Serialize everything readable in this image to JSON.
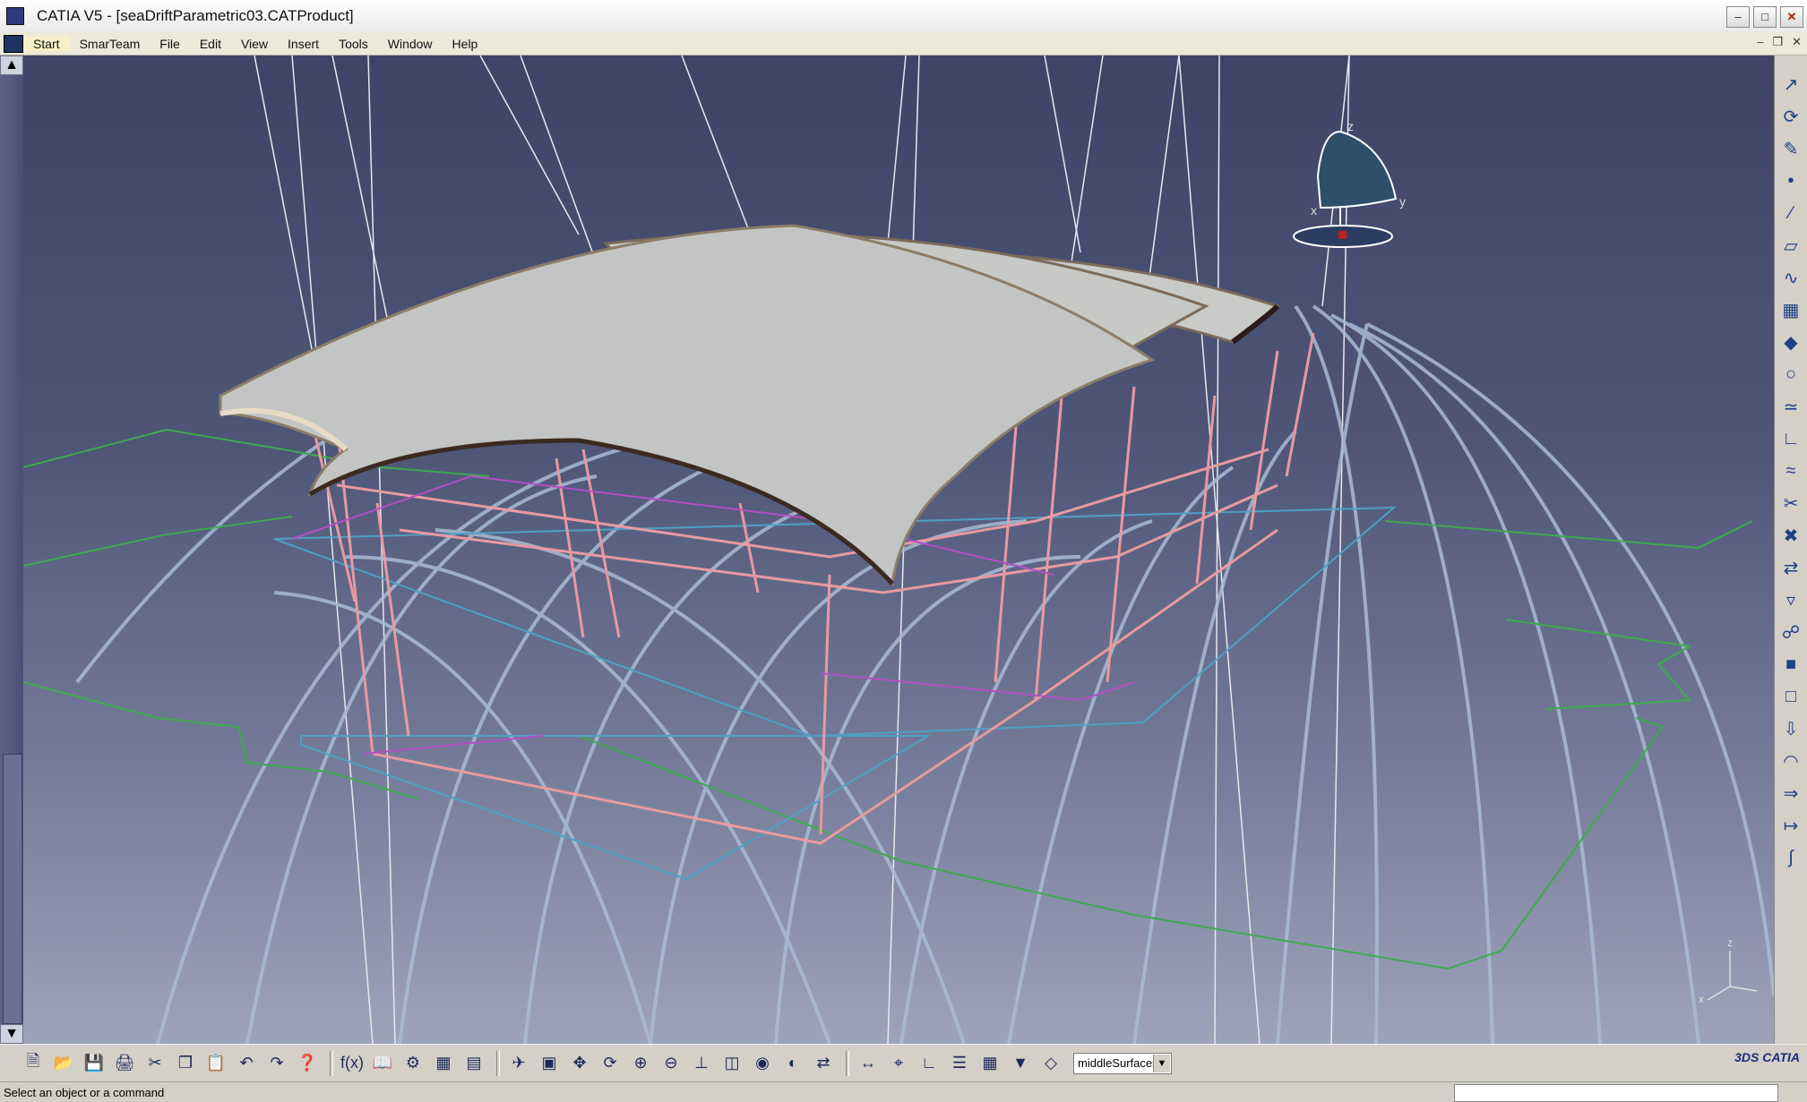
{
  "window": {
    "title": "CATIA V5 - [seaDriftParametric03.CATProduct]"
  },
  "menu": {
    "items": [
      "Start",
      "SmarTeam",
      "File",
      "Edit",
      "View",
      "Insert",
      "Tools",
      "Window",
      "Help"
    ]
  },
  "compass": {
    "axes": [
      "z",
      "y",
      "x"
    ]
  },
  "triad": {
    "axes": [
      "z",
      "x"
    ]
  },
  "toolbar": {
    "selected_value": "middleSurfaces"
  },
  "status": {
    "message": "Select an object or a command"
  },
  "icons": {
    "right_toolbar": [
      "select-icon",
      "rotate-icon",
      "sketch-icon",
      "point-icon",
      "line-icon",
      "plane-icon",
      "sweep-icon",
      "extrude-icon",
      "fill-icon",
      "circle-icon",
      "spline-icon",
      "corner-icon",
      "blend-icon",
      "split-icon",
      "trim-icon",
      "offset-icon",
      "loft-icon",
      "join-icon",
      "surface-icon",
      "boundary-icon",
      "extract-icon",
      "fillet-icon",
      "translate-icon",
      "extrapolate-icon",
      "law-icon"
    ],
    "bottom_toolbar": [
      "new-icon",
      "open-icon",
      "save-icon",
      "print-icon",
      "cut-icon",
      "copy-icon",
      "paste-icon",
      "undo-icon",
      "redo-icon",
      "help-icon",
      "formula-icon",
      "catalog-icon",
      "knowledge-icon",
      "table-icon",
      "design-table-icon",
      "fly-mode-icon",
      "fit-all-icon",
      "pan-icon",
      "rotate-view-icon",
      "zoom-in-icon",
      "zoom-out-icon",
      "normal-view-icon",
      "iso-view-icon",
      "shading-icon",
      "hide-show-icon",
      "swap-icon",
      "measure-icon",
      "snap-icon",
      "axis-icon",
      "tree-icon",
      "grid-icon",
      "filter-icon",
      "layer-icon"
    ]
  }
}
